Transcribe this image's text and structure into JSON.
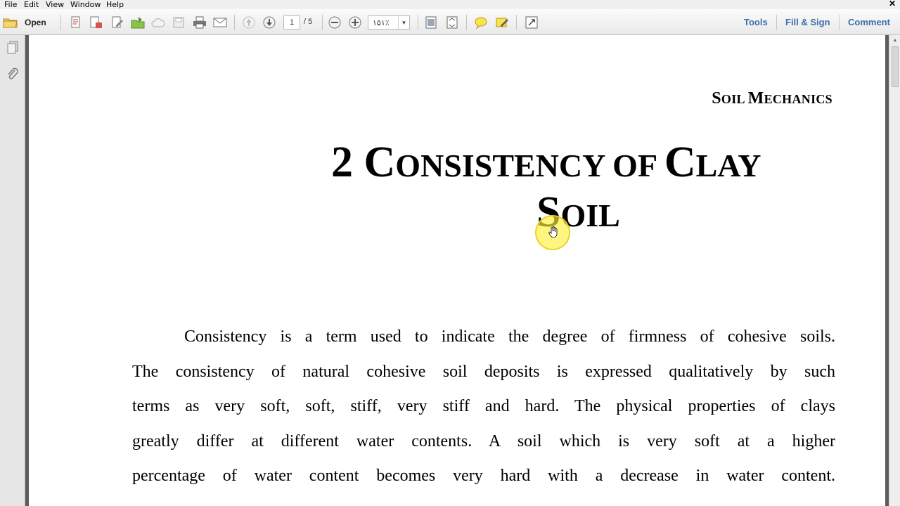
{
  "menu": {
    "items": [
      "File",
      "Edit",
      "View",
      "Window",
      "Help"
    ],
    "close_glyph": "✕"
  },
  "toolbar": {
    "open_label": "Open",
    "icons": [
      "create-pdf-icon",
      "export-pdf-icon",
      "edit-pdf-icon",
      "share-icon",
      "cloud-upload-icon",
      "save-icon",
      "print-icon",
      "email-icon",
      "previous-page-icon",
      "next-page-icon",
      "zoom-out-icon",
      "zoom-in-icon",
      "fit-page-icon",
      "full-screen-icon",
      "comment-icon",
      "highlight-icon",
      "expand-icon"
    ],
    "page_current": "1",
    "page_total": "/ 5",
    "zoom_value": "۱۵۱٪",
    "right_links": [
      "Tools",
      "Fill & Sign",
      "Comment"
    ]
  },
  "sidepanel": {
    "icons": [
      "page-thumbnails-icon",
      "attachments-icon"
    ]
  },
  "document": {
    "running_head_first": "S",
    "running_head_rest": "OIL ",
    "running_head_first2": "M",
    "running_head_rest2": "ECHANICS",
    "title_num": "2 ",
    "title_w1_first": "C",
    "title_w1_rest": "ONSISTENCY OF ",
    "title_w2_first": "C",
    "title_w2_rest": "LAY",
    "title_w3_first": "S",
    "title_w3_rest": "OIL",
    "body_lines": [
      "Consistency is a term used to indicate the degree of firmness of cohesive soils.",
      "The consistency of natural cohesive soil deposits is expressed qualitatively by such",
      "terms as very soft, soft, stiff, very stiff and hard. The physical properties of clays",
      "greatly differ at different water contents. A soil which is very soft at a higher",
      "percentage of water content becomes very hard with a decrease in water content."
    ]
  },
  "colors": {
    "accent_link": "#3b6fa9",
    "cursor_halo": "#fff03c"
  }
}
